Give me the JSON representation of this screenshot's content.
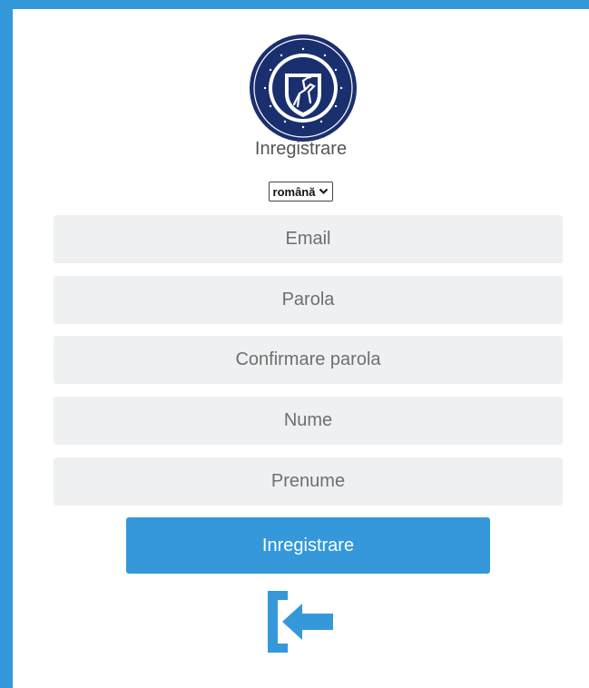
{
  "header": {
    "title": "Inregistrare"
  },
  "language": {
    "selected": "română"
  },
  "form": {
    "email_placeholder": "Email",
    "password_placeholder": "Parola",
    "confirm_password_placeholder": "Confirmare parola",
    "last_name_placeholder": "Nume",
    "first_name_placeholder": "Prenume",
    "submit_label": "Inregistrare"
  },
  "icons": {
    "logo": "university-seal-logo",
    "signin": "sign-in-icon"
  },
  "colors": {
    "accent": "#3498db",
    "field_bg": "#eef0f1",
    "logo_navy": "#1a2f6e"
  }
}
